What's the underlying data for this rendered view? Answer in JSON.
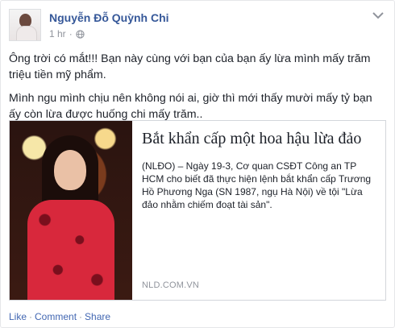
{
  "post": {
    "author": "Nguyễn Đỗ Quỳnh Chi",
    "time": "1 hr",
    "separator": "·",
    "paragraphs": [
      "Ông trời có mắt!!! Bạn này cùng với bạn của bạn ấy lừa mình mấy trăm triệu tiền mỹ phẩm.",
      "Mình ngu mình chịu nên không nói ai, giờ thì mới thấy mười mấy tỷ bạn ấy còn lừa được huống chi mấy trăm.."
    ]
  },
  "link": {
    "title": "Bắt khẩn cấp một hoa hậu lừa đảo",
    "description": "(NLĐO) – Ngày 19-3, Cơ quan CSĐT Công an TP HCM cho biết đã thực hiện lệnh bắt khẩn cấp Trương Hồ Phương Nga (SN 1987, ngụ Hà Nội) về tội \"Lừa đảo nhằm chiếm đoạt tài sản\".",
    "domain": "NLD.COM.VN"
  },
  "actions": {
    "like": "Like",
    "comment": "Comment",
    "share": "Share",
    "separator": "·"
  },
  "icons": {
    "privacy": "globe-icon",
    "menu": "chevron-down-icon"
  },
  "colors": {
    "link_blue": "#365899",
    "action_blue": "#4267b2",
    "muted_gray": "#90949c"
  }
}
